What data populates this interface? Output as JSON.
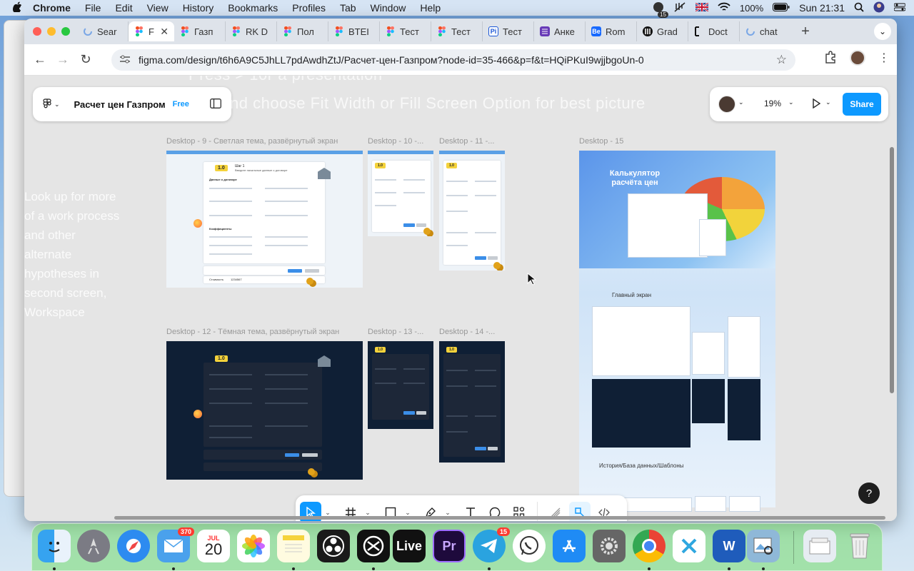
{
  "menubar": {
    "apple": "",
    "app": "Chrome",
    "items": [
      "File",
      "Edit",
      "View",
      "History",
      "Bookmarks",
      "Profiles",
      "Tab",
      "Window",
      "Help"
    ],
    "status_badge": "15",
    "battery": "100%",
    "clock": "Sun 21:31"
  },
  "tabs": [
    {
      "title": "Sear",
      "icon": "loading-icon"
    },
    {
      "title": "F",
      "icon": "figma-icon",
      "active": true
    },
    {
      "title": "Газп",
      "icon": "figma-icon"
    },
    {
      "title": "RK D",
      "icon": "figma-icon"
    },
    {
      "title": "Пол",
      "icon": "figma-icon"
    },
    {
      "title": "BTEI",
      "icon": "figma-icon"
    },
    {
      "title": "Тест",
      "icon": "figma-icon"
    },
    {
      "title": "Тест",
      "icon": "figma-icon"
    },
    {
      "title": "Тест",
      "icon": "pi-icon",
      "fav_text": "Pi"
    },
    {
      "title": "Анке",
      "icon": "forms-icon"
    },
    {
      "title": "Rom",
      "icon": "behance-icon",
      "fav_text": "Be"
    },
    {
      "title": "Grad",
      "icon": "grad-icon"
    },
    {
      "title": "Doct",
      "icon": "doc-icon"
    },
    {
      "title": "chat",
      "icon": "loading-icon"
    }
  ],
  "toolbar": {
    "url": "figma.com/design/t6h6A9C5JhLL7pdAwdhZtJ/Расчет-цен-Газпром?node-id=35-466&p=f&t=HQiPKuI9wjjbgoUn-0"
  },
  "figma": {
    "file_name": "Расчет цен Газпром",
    "plan": "Free",
    "zoom": "19%",
    "share": "Share",
    "help": "?",
    "ghost_top_1": "Press > 10r a presentation",
    "ghost_top_2": "nd choose Fit Width or Fill Screen Option for best picture",
    "ghost_left": "Look up for more of a work process and other alternate hypotheses in second screen, Workspace",
    "frames": {
      "d9": "Desktop - 9 - Светлая тема, развёрнутый экран",
      "d10": "Desktop - 10 -...",
      "d11": "Desktop - 11 -...",
      "d12": "Desktop - 12 - Тёмная тема, развёрнутый экран",
      "d13": "Desktop - 13 -...",
      "d14": "Desktop - 14 -...",
      "d15": "Desktop - 15"
    },
    "d15": {
      "hero_title": "Калькулятор расчёта цен",
      "section_main": "Главный экран",
      "section_history": "История/База данных/Шаблоны"
    },
    "mock": {
      "badge": "1.0",
      "step": "Шаг 1",
      "welcome": "Добро пожаловать",
      "instruction": "Введите начальные данные о договоре",
      "section_contract": "Данные о договоре",
      "section_coeffs": "Коэффициенты",
      "cost_label": "Стоимость",
      "cost_value": "1234567"
    }
  },
  "dock": {
    "mail_badge": "370",
    "calendar_month": "JUL",
    "calendar_day": "20",
    "telegram_badge": "15",
    "live_label": "Live",
    "premiere_label": "Pr",
    "word_label": "W"
  },
  "colors": {
    "figma_blue": "#0d99ff",
    "figma_dark_frame": "#0f1f35",
    "dock_tint": "#78dc6e"
  }
}
